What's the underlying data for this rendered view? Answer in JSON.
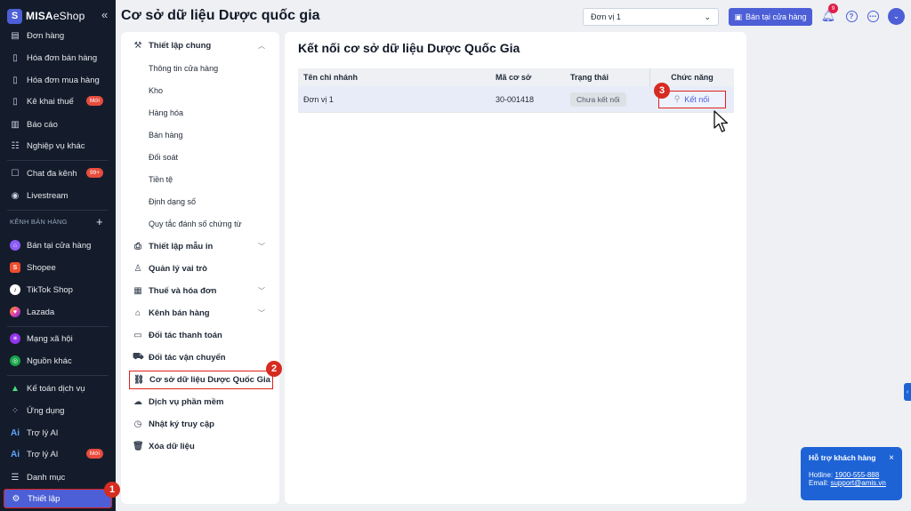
{
  "brand": {
    "bold": "MISA",
    "rest": "eShop"
  },
  "sidebar": {
    "items": [
      {
        "label": "Đơn hàng"
      },
      {
        "label": "Hóa đơn bán hàng"
      },
      {
        "label": "Hóa đơn mua hàng"
      },
      {
        "label": "Kê khai thuế",
        "badge": "Mới"
      },
      {
        "label": "Báo cáo"
      },
      {
        "label": "Nghiệp vụ khác"
      },
      {
        "label": "Chat đa kênh",
        "badge": "99+"
      },
      {
        "label": "Livestream"
      },
      {
        "label": "Bán tại cửa hàng"
      },
      {
        "label": "Shopee"
      },
      {
        "label": "TikTok Shop"
      },
      {
        "label": "Lazada"
      },
      {
        "label": "Mạng xã hội"
      },
      {
        "label": "Nguồn khác"
      },
      {
        "label": "Kế toán dịch vụ"
      },
      {
        "label": "Ứng dụng"
      },
      {
        "label": "Trợ lý AI"
      },
      {
        "label": "Trợ lý AI",
        "badge": "Mới"
      },
      {
        "label": "Danh mục"
      },
      {
        "label": "Thiết lập"
      }
    ],
    "group_label": "KÊNH BÁN HÀNG",
    "group_add": "+"
  },
  "header": {
    "title": "Cơ sở dữ liệu Dược quốc gia",
    "unit_select": "Đơn vị 1",
    "shop_button": "Bán tại cửa hàng",
    "notif_count": "9"
  },
  "settings_menu": {
    "general": "Thiết lập chung",
    "general_sub": [
      "Thông tin cửa hàng",
      "Kho",
      "Hàng hóa",
      "Bán hàng",
      "Đối soát",
      "Tiền tệ",
      "Định dạng số",
      "Quy tắc đánh số chứng từ"
    ],
    "print": "Thiết lập mẫu in",
    "roles": "Quản lý vai trò",
    "tax": "Thuế và hóa đơn",
    "channels": "Kênh bán hàng",
    "payment": "Đối tác thanh toán",
    "shipping": "Đối tác vận chuyển",
    "drug_db": "Cơ sở dữ liệu Dược Quốc Gia",
    "software": "Dịch vụ phần mềm",
    "access_log": "Nhật ký truy cập",
    "delete": "Xóa dữ liệu"
  },
  "main": {
    "title": "Kết nối cơ sở dữ liệu Dược Quốc Gia",
    "columns": [
      "Tên chi nhánh",
      "Mã cơ sở",
      "Trạng thái",
      "Chức năng"
    ],
    "rows": [
      {
        "branch": "Đơn vị 1",
        "code": "30-001418",
        "status": "Chưa kết nối",
        "action": "Kết nối"
      }
    ]
  },
  "steps": [
    "1",
    "2",
    "3"
  ],
  "support": {
    "title": "Hỗ trợ khách hàng",
    "hotline_label": "Hotline:",
    "hotline": "1900-555-888",
    "email_label": "Email:",
    "email": "support@amis.vn",
    "close": "×"
  },
  "colors": {
    "accent": "#4c5fd7",
    "sidebar_bg": "#141c2b",
    "highlight": "#e0201c",
    "support": "#1e63d6"
  }
}
